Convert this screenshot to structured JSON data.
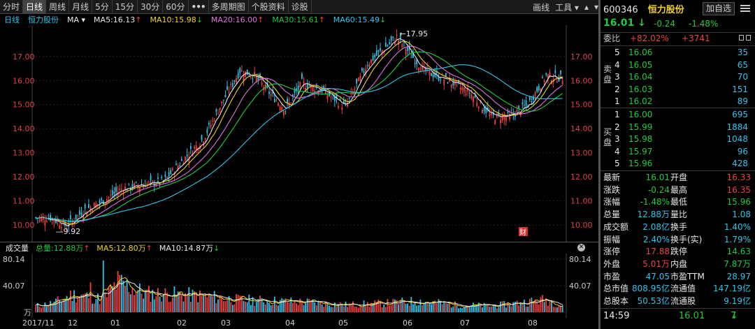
{
  "tabs": [
    "分时",
    "日线",
    "周线",
    "月线",
    "5分",
    "15分",
    "30分",
    "60分",
    "•••",
    "多周期图",
    "个股资料",
    "诊股"
  ],
  "active_tab": 1,
  "toolbar": {
    "draw": "画线",
    "tools": "工具"
  },
  "ma_line": {
    "period": "日线",
    "name": "恒力股份",
    "ma_sel": "MA",
    "items": [
      {
        "label": "MA5:16.13",
        "arrow": "↑",
        "color": "#e8e8e8"
      },
      {
        "label": "MA10:15.98",
        "arrow": "↓",
        "color": "#f2d21b"
      },
      {
        "label": "MA20:16.00",
        "arrow": "↑",
        "color": "#e070e0"
      },
      {
        "label": "MA30:15.61",
        "arrow": "↑",
        "color": "#1ecb3a"
      },
      {
        "label": "MA60:15.49",
        "arrow": "↓",
        "color": "#2ec4ea"
      }
    ]
  },
  "vol_line": {
    "label": "成交量",
    "items": [
      {
        "label": "总量:12.88万",
        "arrow": "↑",
        "color": "#1ecb3a"
      },
      {
        "label": "MA5:12.80万",
        "arrow": "↑",
        "color": "#f2d21b"
      },
      {
        "label": "MA10:14.87万",
        "arrow": "↓",
        "color": "#e8e8e8"
      }
    ]
  },
  "colors": {
    "up": "#f04040",
    "down": "#2ec4ea",
    "bg": "#000000"
  },
  "chart_data": {
    "type": "candlestick",
    "y_ticks": [
      "17.00",
      "16.00",
      "15.00",
      "14.00",
      "13.00",
      "12.00",
      "11.00",
      "10.00"
    ],
    "ylim": [
      9.6,
      17.95
    ],
    "x_labels": [
      "2017/11",
      "12",
      "01",
      "02",
      "03",
      "04",
      "05",
      "06",
      "07",
      "08"
    ],
    "annotations": {
      "max": "17.95",
      "min": "9.92",
      "marker": "财"
    },
    "vol_ticks": [
      "80.14",
      "40.07",
      "万"
    ],
    "vol_ylim": [
      0,
      80.14
    ],
    "anchors": {
      "x": [
        0,
        8,
        17,
        26,
        37,
        47,
        60,
        70,
        82,
        92,
        103,
        112,
        120,
        128,
        137,
        146,
        157,
        170,
        182,
        198,
        213,
        226,
        238,
        250,
        260,
        270,
        280,
        288
      ],
      "y": [
        10.3,
        10.3,
        9.95,
        10.6,
        11.0,
        11.5,
        11.7,
        11.8,
        12.8,
        13.6,
        15.2,
        16.4,
        16.2,
        15.5,
        14.8,
        15.9,
        15.6,
        14.9,
        16.7,
        17.8,
        16.4,
        16.0,
        15.5,
        14.5,
        14.5,
        15.0,
        16.2,
        16.1
      ]
    },
    "vol_anchors": {
      "x": [
        0,
        10,
        20,
        30,
        37,
        45,
        60,
        80,
        95,
        110,
        130,
        150,
        170,
        190,
        210,
        230,
        250,
        265,
        280,
        288
      ],
      "y": [
        10,
        15,
        28,
        25,
        20,
        48,
        30,
        28,
        25,
        20,
        18,
        16,
        12,
        14,
        18,
        12,
        10,
        15,
        20,
        12
      ]
    }
  },
  "quote": {
    "code": "600346",
    "name": "恒力股份",
    "fav": "加自选",
    "price": "16.01",
    "arrow": "↓",
    "change": "-0.24",
    "pct": "-1.48%",
    "weibi_label": "委比",
    "weibi": "+82.02%",
    "weicha": "+3741",
    "sell_label": "卖盘",
    "buy_label": "买盘",
    "sells": [
      {
        "n": "5",
        "p": "16.06",
        "v": "35"
      },
      {
        "n": "4",
        "p": "16.05",
        "v": "65"
      },
      {
        "n": "3",
        "p": "16.04",
        "v": "70"
      },
      {
        "n": "2",
        "p": "16.03",
        "v": "151"
      },
      {
        "n": "1",
        "p": "16.02",
        "v": "89"
      }
    ],
    "buys": [
      {
        "n": "1",
        "p": "16.00",
        "v": "695"
      },
      {
        "n": "2",
        "p": "15.99",
        "v": "1884"
      },
      {
        "n": "3",
        "p": "15.98",
        "v": "1048"
      },
      {
        "n": "4",
        "p": "15.97",
        "v": "96"
      },
      {
        "n": "5",
        "p": "15.96",
        "v": "428"
      }
    ],
    "stats": [
      {
        "l1": "最新",
        "v1": "16.01",
        "c1": "#1ecb3a",
        "l2": "开盘",
        "v2": "16.33",
        "c2": "#f04040"
      },
      {
        "l1": "涨跌",
        "v1": "-0.24",
        "c1": "#1ecb3a",
        "l2": "最高",
        "v2": "16.35",
        "c2": "#f04040"
      },
      {
        "l1": "涨幅",
        "v1": "-1.48%",
        "c1": "#1ecb3a",
        "l2": "最低",
        "v2": "15.96",
        "c2": "#1ecb3a"
      },
      {
        "l1": "总量",
        "v1": "12.88万",
        "c1": "#2ec4ea",
        "l2": "量比",
        "v2": "1.08",
        "c2": "#2ec4ea"
      },
      {
        "l1": "成交额",
        "v1": "2.08亿",
        "c1": "#2ec4ea",
        "l2": "换手",
        "v2": "1.40%",
        "c2": "#2ec4ea"
      },
      {
        "l1": "振幅",
        "v1": "2.40%",
        "c1": "#2ec4ea",
        "l2": "换手(实)",
        "v2": "1.79%",
        "c2": "#2ec4ea"
      },
      {
        "l1": "涨停",
        "v1": "17.88",
        "c1": "#f04040",
        "l2": "跌停",
        "v2": "14.63",
        "c2": "#1ecb3a"
      },
      {
        "l1": "外盘",
        "v1": "5.01万",
        "c1": "#f04040",
        "l2": "内盘",
        "v2": "7.87万",
        "c2": "#1ecb3a"
      },
      {
        "l1": "市盈",
        "v1": "47.05",
        "c1": "#2ec4ea",
        "l2": "市盈TTM",
        "v2": "28.97",
        "c2": "#2ec4ea"
      },
      {
        "l1": "总市值",
        "v1": "808.95亿",
        "c1": "#2ec4ea",
        "l2": "流通值",
        "v2": "147.19亿",
        "c2": "#2ec4ea"
      },
      {
        "l1": "总股本",
        "v1": "50.53亿",
        "c1": "#2ec4ea",
        "l2": "流通股",
        "v2": "9.19亿",
        "c2": "#2ec4ea"
      }
    ],
    "tick": {
      "time": "14:59",
      "price": "16.01",
      "vol": "7",
      "arrow": "↓"
    }
  }
}
